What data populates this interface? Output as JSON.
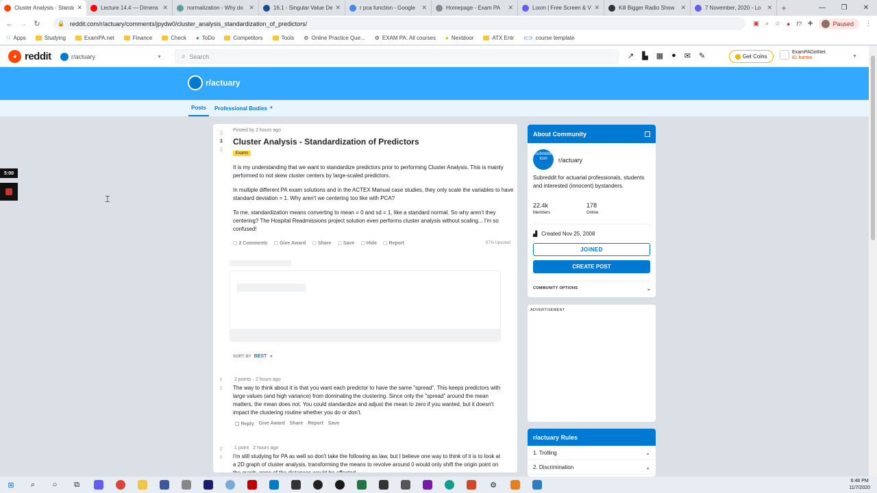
{
  "browser": {
    "tabs": [
      {
        "title": "Cluster Analysis - Standa",
        "color": "#ff4500",
        "active": true
      },
      {
        "title": "Lecture 14.4 — Dimens",
        "color": "#ff0000"
      },
      {
        "title": "normalization - Why do",
        "color": "#5f9ea0"
      },
      {
        "title": "16.1 - Singular Value De",
        "color": "#1a4d8f"
      },
      {
        "title": "r pca function - Google",
        "color": "#4285f4"
      },
      {
        "title": "Homepage - Exam PA",
        "color": "#888888"
      },
      {
        "title": "Loom | Free Screen & V",
        "color": "#625df5"
      },
      {
        "title": "Kill Bigger Radio Show",
        "color": "#333333"
      },
      {
        "title": "7 November, 2020 - Lo",
        "color": "#625df5"
      }
    ],
    "new_tab": "+",
    "url": "reddit.com/r/actuary/comments/jpydw0/cluster_analysis_standardization_of_predictors/",
    "profile_status": "Paused",
    "bookmarks": [
      "Apps",
      "Studying",
      "ExamPA.net",
      "Finance",
      "Check",
      "ToDo",
      "Competitors",
      "Tools",
      "Online Practice Que...",
      "EXAM PA: All courses",
      "Nextdoor",
      "ATX Entr",
      "course template"
    ]
  },
  "reddit": {
    "wordmark": "reddit",
    "community_dropdown": "r/actuary",
    "search_placeholder": "Search",
    "get_coins": "Get Coins",
    "username": "ExamPADotNet",
    "karma": "81 karma",
    "subreddit_name": "r/actuary",
    "nav": {
      "posts": "Posts",
      "professional_bodies": "Professional Bodies"
    }
  },
  "post": {
    "score": "1",
    "meta": "Posted by 2 hours ago",
    "title": "Cluster Analysis - Standardization of Predictors",
    "flair": "Exams",
    "paragraphs": [
      "It is my understanding that we want to standardize predictors prior to performing Cluster Analysis. This is mainly performed to not skew cluster centers by large-scaled predictors.",
      "In multiple different PA exam solutions and in the ACTEX Manual case studies, they only scale the variables to have standard deviation = 1. Why aren't we centering too like with PCA?",
      "To me, standardization means converting to mean = 0 and sd = 1, like a standard normal. So why aren't they centering? The Hospital Readmissions project solution even performs cluster analysis without scaling... I'm so confused!"
    ],
    "actions": {
      "comments": "2 Comments",
      "award": "Give Award",
      "share": "Share",
      "save": "Save",
      "hide": "Hide",
      "report": "Report"
    },
    "upvoted": "67% Upvoted",
    "sort_label": "SORT BY",
    "sort_value": "BEST"
  },
  "comments": [
    {
      "meta": "2 points · 2 hours ago",
      "body": "The way to think about it is that you want each predictor to have the same \"spread\". This keeps predictors with large values (and high variance) from dominating the clustering. Since only the \"spread\" around the mean matters, the mean does not. You could standardize and adjust the mean to zero if you wanted, but it doesn't impact the clustering routine whether you do or don't.",
      "actions": [
        "Reply",
        "Give Award",
        "Share",
        "Report",
        "Save"
      ]
    },
    {
      "meta": "1 point · 2 hours ago",
      "body": "I'm still studying for PA as well so don't take the following as law, but I believe one way to think of it is to look at a 2D graph of cluster analysis, transforming the means to revolve around 0 would only shift the origin point on the graph, none of the distances would be effected.",
      "actions": []
    }
  ],
  "sidebar": {
    "about_title": "About Community",
    "icon_alt": "Subreddit Icon",
    "community_name": "r/actuary",
    "description": "Subreddit for actuarial professionals, students and interested (innocent) bystanders.",
    "members_value": "22.4k",
    "members_label": "Members",
    "online_value": "178",
    "online_label": "Online",
    "created": "Created Nov 25, 2008",
    "joined_button": "JOINED",
    "create_post_button": "CREATE POST",
    "community_options": "COMMUNITY OPTIONS",
    "advertisement": "ADVERTISEMENT",
    "rules_title": "r/actuary Rules",
    "rules": [
      "1. Trolling",
      "2. Discrimination"
    ]
  },
  "overlay": {
    "timer": "5:00"
  },
  "taskbar": {
    "time": "6:48 PM",
    "date": "11/7/2020"
  }
}
